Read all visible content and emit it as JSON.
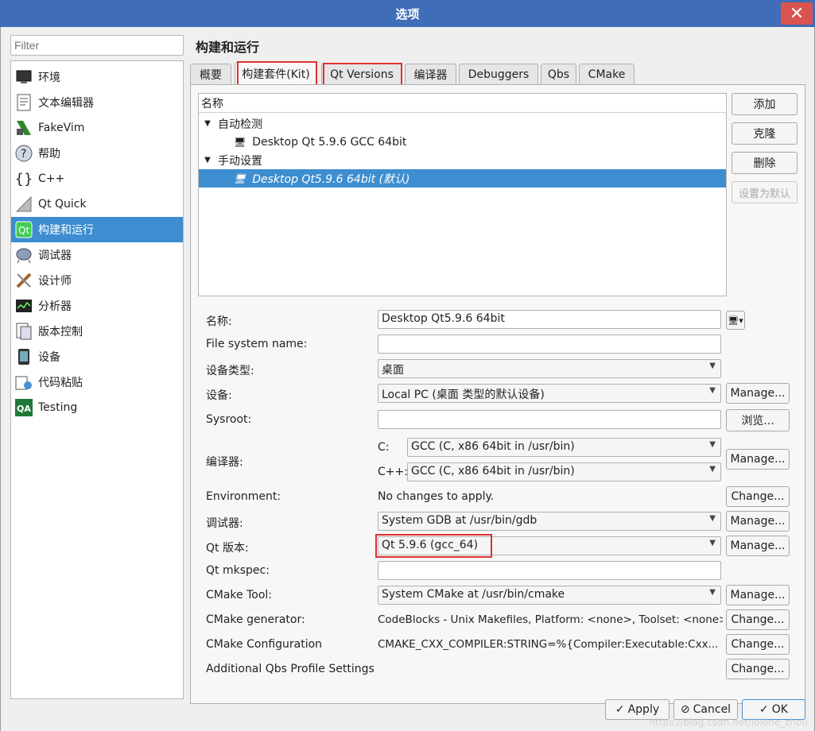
{
  "window": {
    "title": "选项",
    "close_glyph": "✕"
  },
  "filter": {
    "placeholder": "Filter"
  },
  "sidebar": {
    "items": [
      {
        "label": "环境",
        "icon": "monitor-icon"
      },
      {
        "label": "文本编辑器",
        "icon": "text-editor-icon"
      },
      {
        "label": "FakeVim",
        "icon": "fakevim-icon"
      },
      {
        "label": "帮助",
        "icon": "help-icon"
      },
      {
        "label": "C++",
        "icon": "cpp-braces-icon"
      },
      {
        "label": "Qt Quick",
        "icon": "qtquick-icon"
      },
      {
        "label": "构建和运行",
        "icon": "qt-build-icon"
      },
      {
        "label": "调试器",
        "icon": "debugger-icon"
      },
      {
        "label": "设计师",
        "icon": "designer-icon"
      },
      {
        "label": "分析器",
        "icon": "analyzer-icon"
      },
      {
        "label": "版本控制",
        "icon": "version-control-icon"
      },
      {
        "label": "设备",
        "icon": "device-icon"
      },
      {
        "label": "代码粘贴",
        "icon": "code-paste-icon"
      },
      {
        "label": "Testing",
        "icon": "qa-testing-icon"
      }
    ],
    "selected": "构建和运行"
  },
  "page": {
    "title": "构建和运行"
  },
  "tabs": [
    {
      "label": "概要"
    },
    {
      "label": "构建套件(Kit)"
    },
    {
      "label": "Qt Versions"
    },
    {
      "label": "编译器"
    },
    {
      "label": "Debuggers"
    },
    {
      "label": "Qbs"
    },
    {
      "label": "CMake"
    }
  ],
  "tree": {
    "header": "名称",
    "group_auto": "自动检测",
    "kit_auto": "Desktop Qt 5.9.6 GCC 64bit",
    "group_manual": "手动设置",
    "kit_manual": "Desktop Qt5.9.6 64bit (默认)"
  },
  "kit_buttons": {
    "add": "添加",
    "clone": "克隆",
    "remove": "删除",
    "make_default": "设置为默认"
  },
  "form": {
    "name_label": "名称:",
    "name_value": "Desktop Qt5.9.6 64bit",
    "fs_label": "File system name:",
    "fs_value": "",
    "device_type_label": "设备类型:",
    "device_type_value": "桌面",
    "device_label": "设备:",
    "device_value": "Local PC (桌面 类型的默认设备)",
    "sysroot_label": "Sysroot:",
    "sysroot_value": "",
    "browse": "浏览...",
    "compiler_label": "编译器:",
    "c_label": "C:",
    "c_value": "GCC (C, x86 64bit in /usr/bin)",
    "cpp_label": "C++:",
    "cpp_value": "GCC (C, x86 64bit in /usr/bin)",
    "env_label": "Environment:",
    "env_value": "No changes to apply.",
    "debugger_label": "调试器:",
    "debugger_value": "System GDB at /usr/bin/gdb",
    "qt_version_label": "Qt 版本:",
    "qt_version_value": "Qt 5.9.6 (gcc_64)",
    "mkspec_label": "Qt mkspec:",
    "mkspec_value": "",
    "cmake_tool_label": "CMake Tool:",
    "cmake_tool_value": "System CMake at /usr/bin/cmake",
    "cmake_gen_label": "CMake generator:",
    "cmake_gen_value": "CodeBlocks - Unix Makefiles, Platform: <none>, Toolset: <none>",
    "cmake_conf_label": "CMake Configuration",
    "cmake_conf_value": "CMAKE_CXX_COMPILER:STRING=%{Compiler:Executable:Cxx...",
    "qbs_label": "Additional Qbs Profile Settings",
    "manage": "Manage...",
    "change": "Change..."
  },
  "footer": {
    "apply": "Apply",
    "cancel": "Cancel",
    "ok": "OK"
  },
  "watermark": "https://blog.csdn.net/lolone_zhou",
  "colors": {
    "titlebar": "#3f6db7",
    "selection": "#3d8ed0",
    "highlight_box": "#e0302f"
  }
}
